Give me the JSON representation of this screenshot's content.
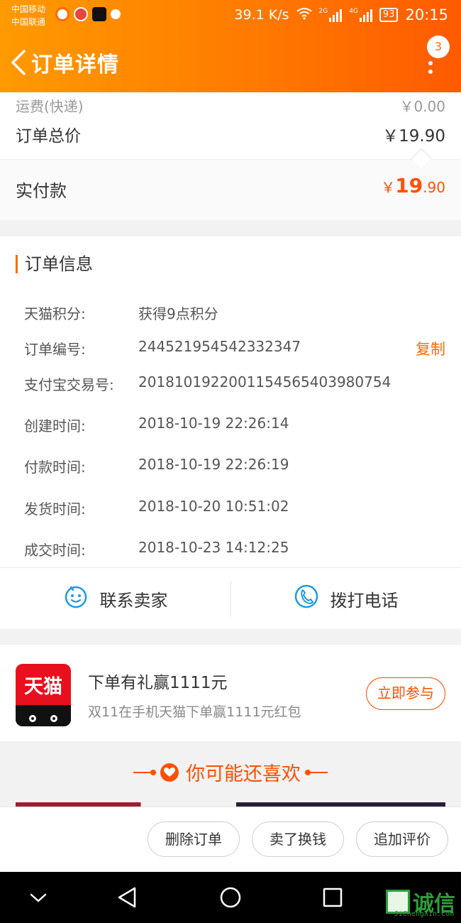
{
  "status_bar": {
    "carrier_1": "中国移动",
    "carrier_2": "中国联通",
    "net_speed": "39.1 K/s",
    "network_1": "2G",
    "network_2": "4G",
    "battery": "93",
    "time": "20:15"
  },
  "header": {
    "title": "订单详情",
    "badge_count": "3"
  },
  "price": {
    "shipping_label": "运费(快递)",
    "shipping_value": "￥0.00",
    "total_label": "订单总价",
    "total_value": "￥19.90",
    "paid_label": "实付款",
    "paid_currency": "￥",
    "paid_int": "19",
    "paid_dec": ".90"
  },
  "order_info": {
    "title": "订单信息",
    "rows": [
      {
        "label": "天猫积分:",
        "value": "获得9点积分"
      },
      {
        "label": "订单编号:",
        "value": "244521954542332347"
      },
      {
        "label": "支付宝交易号:",
        "value": "2018101922001154565403980754"
      },
      {
        "label": "创建时间:",
        "value": "2018-10-19 22:26:14"
      },
      {
        "label": "付款时间:",
        "value": "2018-10-19 22:26:19"
      },
      {
        "label": "发货时间:",
        "value": "2018-10-20 10:51:02"
      },
      {
        "label": "成交时间:",
        "value": "2018-10-23 14:12:25"
      }
    ],
    "copy_label": "复制"
  },
  "contact": {
    "seller_label": "联系卖家",
    "phone_label": "拨打电话"
  },
  "promo": {
    "logo_text": "天猫",
    "title": "下单有礼赢1111元",
    "subtitle": "双11在手机天猫下单赢1111元红包",
    "button": "立即参与"
  },
  "recommend": {
    "title": "你可能还喜欢"
  },
  "actions": {
    "delete": "删除订单",
    "resell": "卖了换钱",
    "review": "追加评价"
  },
  "watermark": {
    "text": "诚信",
    "sub": "JiChengXin.com"
  },
  "colors": {
    "accent": "#ff5000",
    "header_start": "#ff9a00",
    "header_end": "#ff5a00",
    "tmall_red": "#e8101e"
  }
}
